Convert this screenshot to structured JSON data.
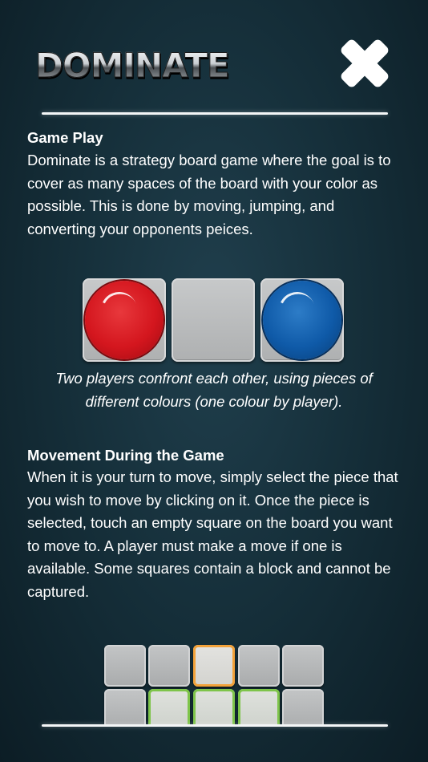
{
  "header": {
    "logo_text": "DOMINATE",
    "close_icon": "close-x-icon"
  },
  "sections": {
    "game_play": {
      "title": "Game Play",
      "text": "Dominate is a strategy board game where the goal is to cover as many spaces of the board with your color as possible. This is done by moving, jumping, and converting your opponents peices."
    },
    "pieces_caption": "Two players confront each other, using pieces of different colours (one colour by player).",
    "movement": {
      "title": "Movement During the Game",
      "text": "When it is your turn to move, simply select the piece that you wish to move by clicking on it. Once the piece is selected, touch an empty square on the board you want to move to. A player must make a move if one is available. Some squares contain a block and cannot be captured."
    }
  },
  "illustration_pieces": [
    "red",
    "empty",
    "blue"
  ],
  "board_illustration": {
    "rows": [
      [
        "empty",
        "empty",
        "selected",
        "empty",
        "empty"
      ],
      [
        "empty",
        "target",
        "target",
        "target",
        "empty"
      ]
    ]
  },
  "colors": {
    "selected_outline": "#f2a23a",
    "target_outline": "#7ec44a",
    "red_piece": "#d4161e",
    "blue_piece": "#0f5aa8"
  }
}
